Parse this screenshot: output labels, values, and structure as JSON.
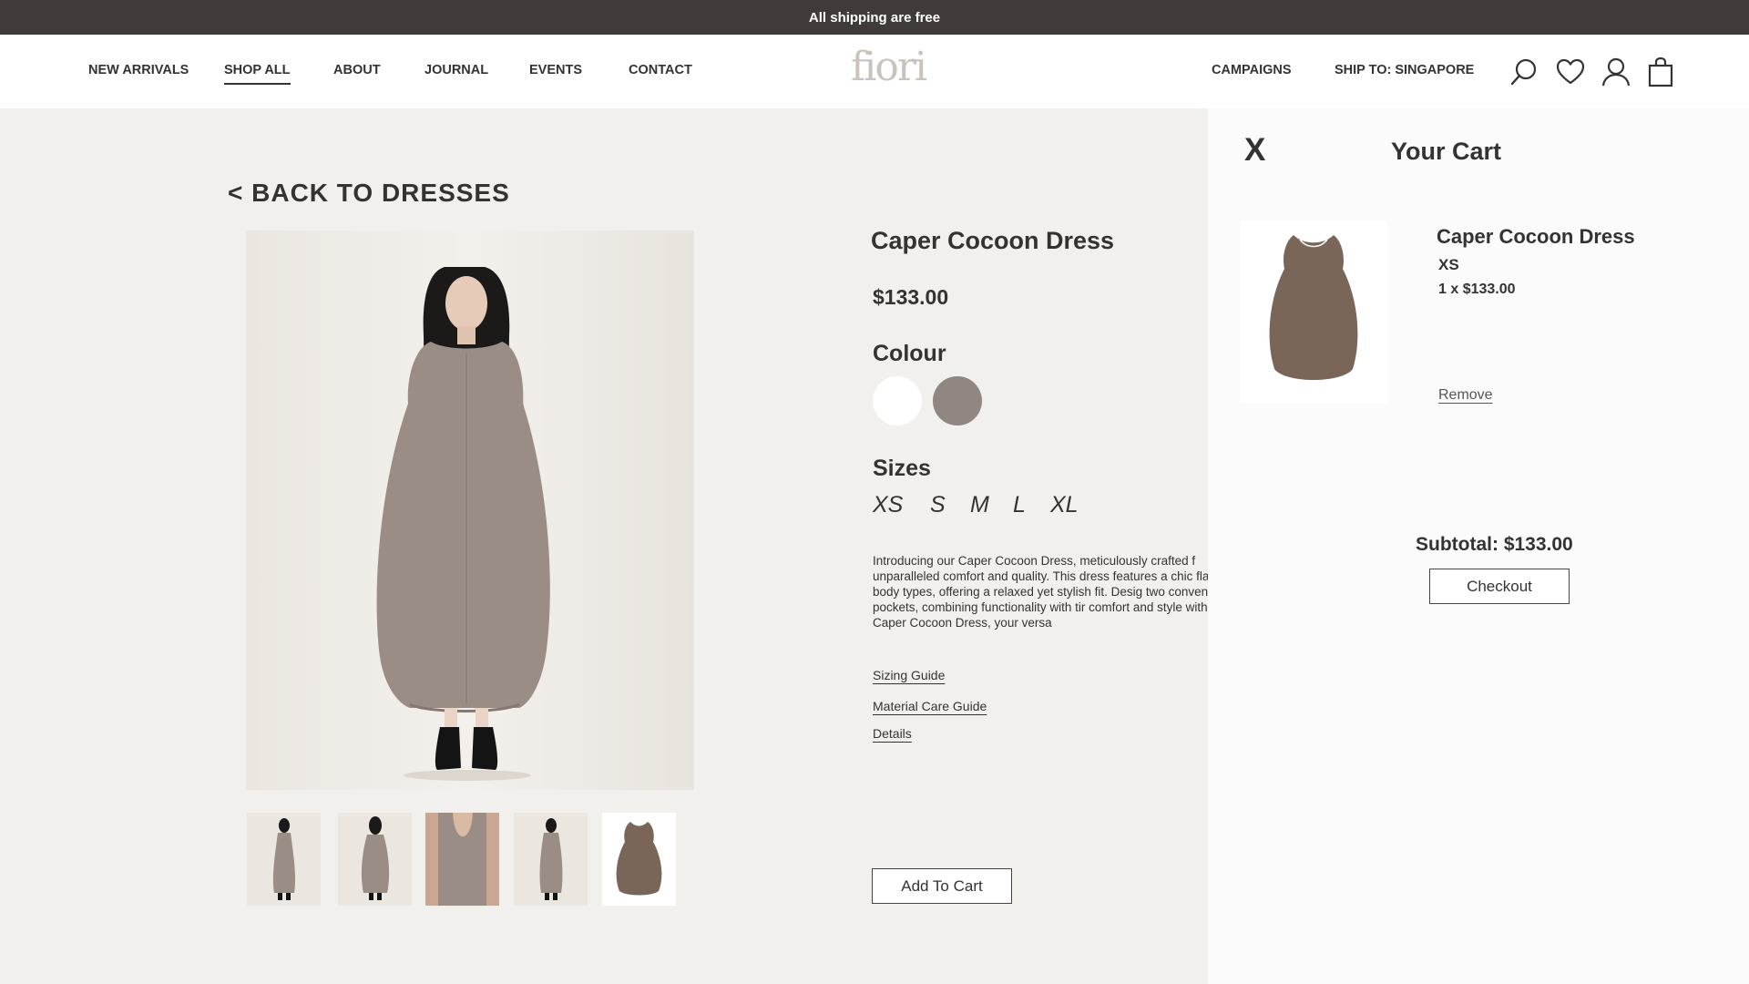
{
  "promo": {
    "text": "All shipping are free"
  },
  "nav": {
    "left": [
      "NEW ARRIVALS",
      "SHOP ALL",
      "ABOUT",
      "JOURNAL",
      "EVENTS",
      "CONTACT"
    ],
    "active": "SHOP ALL",
    "right": [
      "CAMPAIGNS",
      "SHIP TO: SINGAPORE"
    ],
    "logo": "fiori",
    "icons": [
      "search-icon",
      "heart-icon",
      "account-icon",
      "shopping-bag-icon"
    ]
  },
  "product": {
    "back_label": "< BACK TO DRESSES",
    "title": "Caper Cocoon Dress",
    "price": "$133.00",
    "colour_label": "Colour",
    "colours": [
      "#ffffff",
      "#908682"
    ],
    "sizes_label": "Sizes",
    "sizes": [
      "XS",
      "S",
      "M",
      "L",
      "XL"
    ],
    "description": "Introducing our Caper Cocoon Dress, meticulously crafted f unparalleled comfort and quality. This dress features a chic flatters all body types, offering a relaxed yet stylish fit. Desig two convenient side pockets, combining functionality with tir comfort and style with the Caper Cocoon Dress, your versa",
    "links": [
      "Sizing Guide",
      "Material Care Guide",
      "Details"
    ],
    "add_to_cart": "Add To Cart"
  },
  "cart": {
    "close": "X",
    "title": "Your Cart",
    "item": {
      "name": "Caper Cocoon Dress",
      "size": "XS",
      "qty_price": "1 x $133.00",
      "remove": "Remove"
    },
    "subtotal": "Subtotal: $133.00",
    "checkout": "Checkout"
  },
  "colors": {
    "promo_bg": "#403b39",
    "page_bg": "#f2f0ed",
    "dress": "#9a8d86",
    "dress_flat": "#7a6658"
  }
}
